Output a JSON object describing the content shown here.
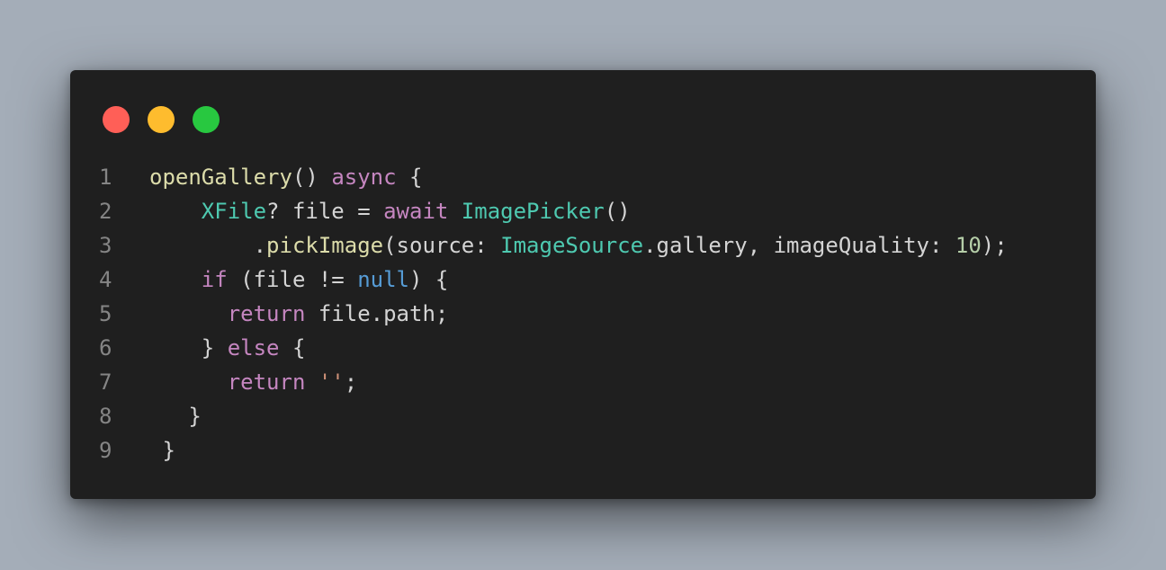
{
  "window": {
    "traffic_lights": [
      {
        "name": "close",
        "color": "#ff5f57"
      },
      {
        "name": "minimize",
        "color": "#febc2e"
      },
      {
        "name": "maximize",
        "color": "#28c840"
      }
    ]
  },
  "colors": {
    "plain": "#d4d4d4",
    "function": "#dcdcaa",
    "keyword": "#c586c0",
    "type": "#4ec9b0",
    "constant": "#569cd6",
    "number": "#b5cea8",
    "string": "#ce9178",
    "line_number": "#858585"
  },
  "code": {
    "lines": [
      {
        "number": "1",
        "tokens": [
          {
            "t": "openGallery",
            "k": "function"
          },
          {
            "t": "() ",
            "k": "plain"
          },
          {
            "t": "async",
            "k": "keyword"
          },
          {
            "t": " {",
            "k": "plain"
          }
        ]
      },
      {
        "number": "2",
        "tokens": [
          {
            "t": "    ",
            "k": "plain"
          },
          {
            "t": "XFile",
            "k": "type"
          },
          {
            "t": "? file = ",
            "k": "plain"
          },
          {
            "t": "await",
            "k": "keyword"
          },
          {
            "t": " ",
            "k": "plain"
          },
          {
            "t": "ImagePicker",
            "k": "type"
          },
          {
            "t": "()",
            "k": "plain"
          }
        ]
      },
      {
        "number": "3",
        "tokens": [
          {
            "t": "        .",
            "k": "plain"
          },
          {
            "t": "pickImage",
            "k": "function"
          },
          {
            "t": "(source: ",
            "k": "plain"
          },
          {
            "t": "ImageSource",
            "k": "type"
          },
          {
            "t": ".gallery, imageQuality: ",
            "k": "plain"
          },
          {
            "t": "10",
            "k": "number"
          },
          {
            "t": ");",
            "k": "plain"
          }
        ]
      },
      {
        "number": "4",
        "tokens": [
          {
            "t": "    ",
            "k": "plain"
          },
          {
            "t": "if",
            "k": "keyword"
          },
          {
            "t": " (file != ",
            "k": "plain"
          },
          {
            "t": "null",
            "k": "constant"
          },
          {
            "t": ") {",
            "k": "plain"
          }
        ]
      },
      {
        "number": "5",
        "tokens": [
          {
            "t": "      ",
            "k": "plain"
          },
          {
            "t": "return",
            "k": "keyword"
          },
          {
            "t": " file.path;",
            "k": "plain"
          }
        ]
      },
      {
        "number": "6",
        "tokens": [
          {
            "t": "    } ",
            "k": "plain"
          },
          {
            "t": "else",
            "k": "keyword"
          },
          {
            "t": " {",
            "k": "plain"
          }
        ]
      },
      {
        "number": "7",
        "tokens": [
          {
            "t": "      ",
            "k": "plain"
          },
          {
            "t": "return",
            "k": "keyword"
          },
          {
            "t": " ",
            "k": "plain"
          },
          {
            "t": "''",
            "k": "string"
          },
          {
            "t": ";",
            "k": "plain"
          }
        ]
      },
      {
        "number": "8",
        "tokens": [
          {
            "t": "   }",
            "k": "plain"
          }
        ]
      },
      {
        "number": "9",
        "tokens": [
          {
            "t": " }",
            "k": "plain"
          }
        ]
      }
    ]
  }
}
